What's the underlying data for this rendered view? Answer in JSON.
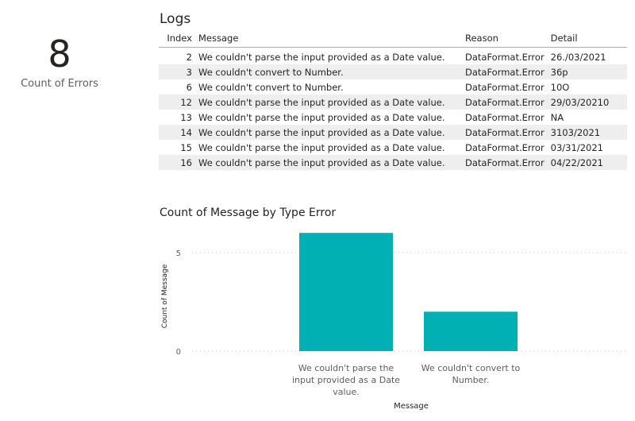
{
  "card": {
    "value": "8",
    "label": "Count of Errors"
  },
  "logs": {
    "title": "Logs",
    "columns": [
      "Index",
      "Message",
      "Reason",
      "Detail"
    ],
    "rows": [
      {
        "index": "2",
        "message": "We couldn't parse the input provided as a Date value.",
        "reason": "DataFormat.Error",
        "detail": "26./03/2021"
      },
      {
        "index": "3",
        "message": "We couldn't convert to Number.",
        "reason": "DataFormat.Error",
        "detail": "36p"
      },
      {
        "index": "6",
        "message": "We couldn't convert to Number.",
        "reason": "DataFormat.Error",
        "detail": "10O"
      },
      {
        "index": "12",
        "message": "We couldn't parse the input provided as a Date value.",
        "reason": "DataFormat.Error",
        "detail": "29/03/20210"
      },
      {
        "index": "13",
        "message": "We couldn't parse the input provided as a Date value.",
        "reason": "DataFormat.Error",
        "detail": "NA"
      },
      {
        "index": "14",
        "message": "We couldn't parse the input provided as a Date value.",
        "reason": "DataFormat.Error",
        "detail": "3103/2021"
      },
      {
        "index": "15",
        "message": "We couldn't parse the input provided as a Date value.",
        "reason": "DataFormat.Error",
        "detail": "03/31/2021"
      },
      {
        "index": "16",
        "message": "We couldn't parse the input provided as a Date value.",
        "reason": "DataFormat.Error",
        "detail": "04/22/2021"
      }
    ]
  },
  "colors": {
    "bar": "#01B0B2",
    "header_rule": "#7fb6e4",
    "stripe": "#eeeeee"
  },
  "chart_data": {
    "type": "bar",
    "title": "Count of Message by Type Error",
    "xlabel": "Message",
    "ylabel": "Count of Message",
    "categories": [
      [
        "We couldn't parse the",
        "input provided as a Date",
        "value."
      ],
      [
        "We couldn't convert to",
        "Number."
      ]
    ],
    "category_names": [
      "We couldn't parse the input provided as a Date value.",
      "We couldn't convert to Number."
    ],
    "values": [
      6,
      2
    ],
    "yticks": [
      0,
      5
    ],
    "ylim": [
      0,
      6.2
    ],
    "grid": true,
    "legend": "none"
  }
}
